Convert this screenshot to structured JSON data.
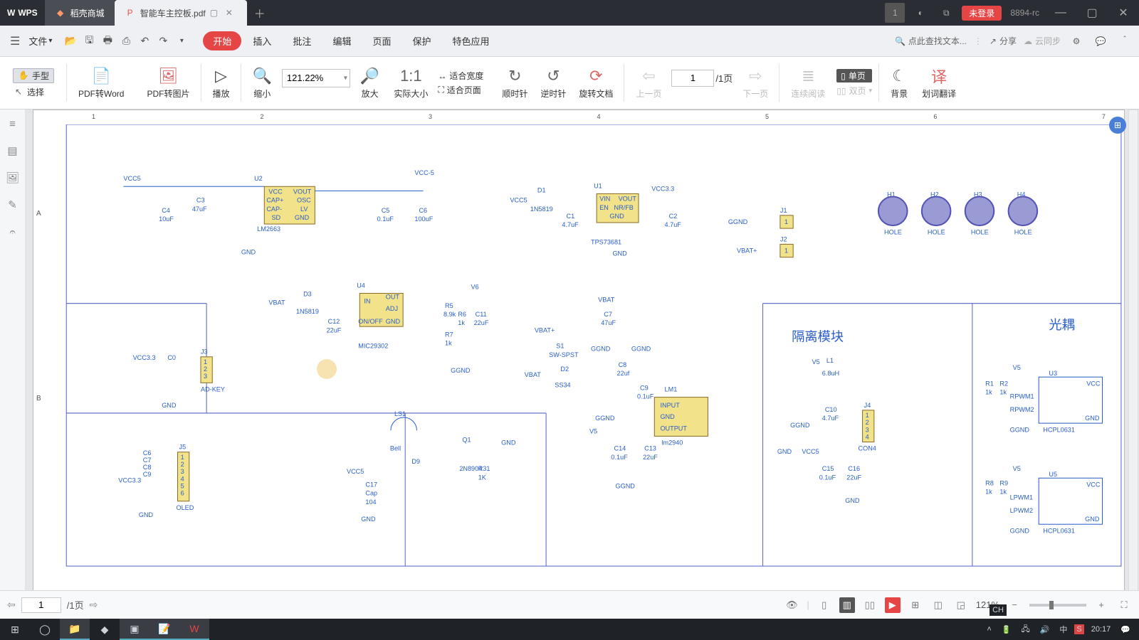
{
  "titlebar": {
    "app": "WPS",
    "tabs": [
      {
        "label": "稻壳商城",
        "type": "store"
      },
      {
        "label": "智能车主控板.pdf",
        "type": "active"
      }
    ],
    "login": "未登录",
    "version": "8894-rc",
    "badge": "1"
  },
  "menubar": {
    "file": "文件",
    "menus": [
      "开始",
      "插入",
      "批注",
      "编辑",
      "页面",
      "保护",
      "特色应用"
    ],
    "active_menu": 0,
    "search_placeholder": "点此查找文本...",
    "share": "分享",
    "cloud": "云同步"
  },
  "ribbon": {
    "tool_hand": "手型",
    "tool_select": "选择",
    "pdf_word": "PDF转Word",
    "pdf_image": "PDF转图片",
    "play": "播放",
    "zoom_out": "缩小",
    "zoom_value": "121.22%",
    "zoom_in": "放大",
    "actual": "实际大小",
    "fit_width": "适合宽度",
    "fit_page": "适合页面",
    "rotate_cw": "顺时针",
    "rotate_ccw": "逆时针",
    "rotate_doc": "旋转文档",
    "prev_page": "上一页",
    "page_current": "1",
    "page_total": "/1页",
    "next_page": "下一页",
    "continuous": "连续阅读",
    "single_page": "单页",
    "double_page": "双页",
    "background": "背景",
    "translate": "划词翻译"
  },
  "doc": {
    "ruler": [
      "1",
      "2",
      "3",
      "4",
      "5",
      "6",
      "7"
    ],
    "row_labels": [
      "A",
      "B"
    ],
    "iso_title": "隔离模块",
    "opto_title": "光耦",
    "holes": [
      "H1",
      "H2",
      "H3",
      "H4"
    ],
    "hole_label": "HOLE",
    "nets": {
      "vcc5": "VCC5",
      "vcc_5": "VCC-5",
      "vcc33": "VCC3.3",
      "gnd": "GND",
      "ggnd": "GGND",
      "vbat": "VBAT",
      "vbat_plus": "VBAT+",
      "v5": "V5",
      "v6": "V6"
    },
    "parts": {
      "u2": "U2",
      "u2_chip": "LM2663",
      "u2_pins": [
        "VCC",
        "VOUT",
        "CAP+",
        "OSC",
        "CAP-",
        "LV",
        "SD",
        "GND"
      ],
      "u1": "U1",
      "u1_chip": "TPS73681",
      "u1_pins": [
        "VIN",
        "VOUT",
        "EN",
        "NR/FB",
        "GND"
      ],
      "u4": "U4",
      "u4_chip": "MIC29302",
      "u4_pins": [
        "IN",
        "OUT",
        "ADJ",
        "ON/OFF",
        "GND"
      ],
      "u3": "U3",
      "u3_chip": "HCPL0631",
      "u3_pins": [
        "VCC",
        "RPWM1",
        "RPWM2",
        "GND"
      ],
      "u5": "U5",
      "u5_chip": "HCPL0631",
      "u5_pins": [
        "VCC",
        "LPWM1",
        "LPWM2",
        "GND"
      ],
      "lm1": "LM1",
      "lm1_chip": "lm2940",
      "lm1_pins": [
        "INPUT",
        "GND",
        "OUTPUT"
      ],
      "d1": "D1",
      "d1_part": "1N5819",
      "d3": "D3",
      "d3_part": "1N5819",
      "d2": "D2",
      "d2_part": "SS34",
      "d9": "D9",
      "s1": "S1",
      "s1_part": "SW-SPST",
      "q1": "Q1",
      "q1_part": "2N8904",
      "ls1": "LS1",
      "ls1_part": "Bell",
      "l1": "L1",
      "l1_val": "6.8uH",
      "j1": "J1",
      "j2": "J2",
      "j3": "J3",
      "j3_part": "AD-KEY",
      "j4": "J4",
      "j4_part": "CON4",
      "j5": "J5",
      "j5_part": "OLED",
      "c3": "C3",
      "c3_val": "47uF",
      "c4": "C4",
      "c4_val": "10uF",
      "c5": "C5",
      "c5_val": "0.1uF",
      "c6": "C6",
      "c6_val": "100uF",
      "c1": "C1",
      "c1_val": "4.7uF",
      "c2": "C2",
      "c2_val": "4.7uF",
      "c7": "C7",
      "c7_val": "47uF",
      "c8": "C8",
      "c8_val": "22uF",
      "c9": "C9",
      "c9_val": "0.1uF",
      "c10": "C10",
      "c10_val": "4.7uF",
      "c11": "C11",
      "c11_val": "22uF",
      "c12": "C12",
      "c12_val": "22uF",
      "c13": "C13",
      "c13_val": "22uF",
      "c14": "C14",
      "c14_val": "0.1uF",
      "c15": "C15",
      "c15_val": "0.1uF",
      "c16": "C16",
      "c16_val": "22uF",
      "c17": "C17",
      "c17_part": "Cap",
      "c17_val": "104",
      "c0": "C0",
      "r5": "R5",
      "r5_val": "8.9k",
      "r6": "R6",
      "r6_val": "1k",
      "r7": "R7",
      "r7_val": "1k",
      "r31": "R31",
      "r31_val": "1K",
      "r1": "R1",
      "r1_val": "1k",
      "r2": "R2",
      "r2_val": "1k",
      "r8": "R8",
      "r8_val": "1k",
      "r9": "R9",
      "r9_val": "1k"
    }
  },
  "statusbar": {
    "page_current": "1",
    "page_total": "/1页",
    "zoom": "121%"
  },
  "taskbar": {
    "ime": "CH",
    "clock": "20:17",
    "lang": "中"
  }
}
